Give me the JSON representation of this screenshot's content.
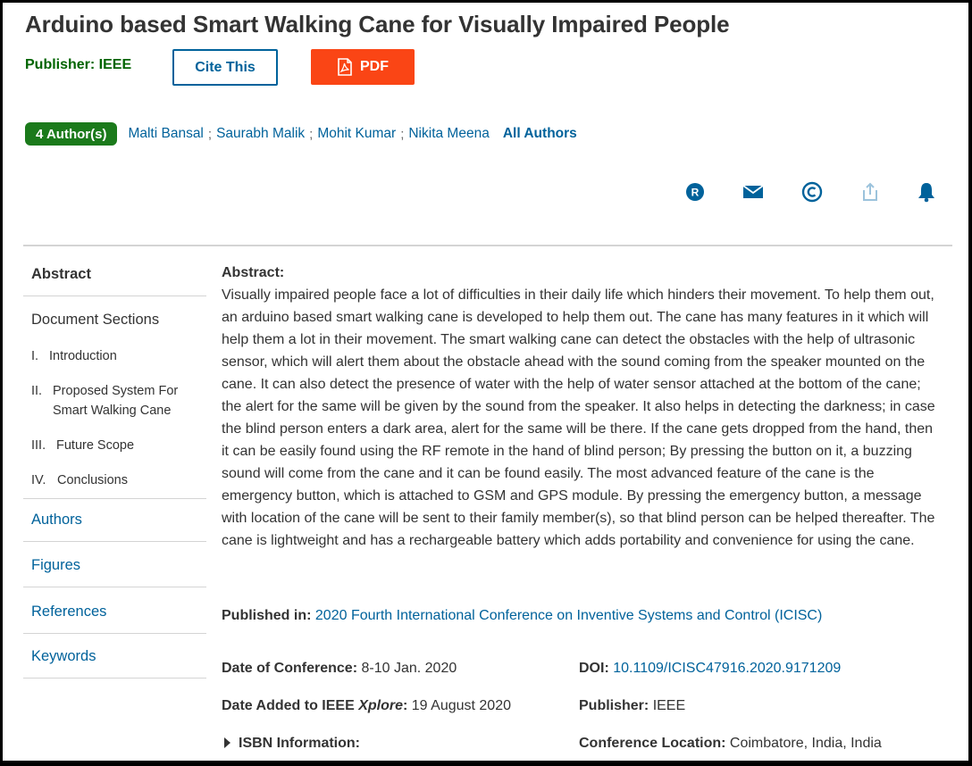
{
  "article": {
    "title": "Arduino based Smart Walking Cane for Visually Impaired People",
    "publisher_label": "Publisher: IEEE",
    "cite_label": "Cite This",
    "pdf_label": "PDF"
  },
  "authors": {
    "badge": "4 Author(s)",
    "names": [
      "Malti Bansal",
      "Saurabh Malik",
      "Mohit Kumar",
      "Nikita Meena"
    ],
    "separator": ";",
    "all_label": "All Authors"
  },
  "action_icons": [
    "rightslink-icon",
    "email-icon",
    "copyright-icon",
    "share-icon",
    "alert-bell-icon"
  ],
  "colors": {
    "link": "#00629b",
    "publisher_green": "#006400",
    "badge_green": "#1b7a1b",
    "pdf_orange": "#fa4515"
  },
  "sidebar": {
    "abstract": "Abstract",
    "document_sections": "Document Sections",
    "sections": [
      {
        "num": "I.",
        "label": "Introduction"
      },
      {
        "num": "II.",
        "label": "Proposed System For Smart Walking Cane"
      },
      {
        "num": "III.",
        "label": "Future Scope"
      },
      {
        "num": "IV.",
        "label": "Conclusions"
      }
    ],
    "authors": "Authors",
    "figures": "Figures",
    "references": "References",
    "keywords": "Keywords"
  },
  "abstract": {
    "heading": "Abstract:",
    "text": "Visually impaired people face a lot of difficulties in their daily life which hinders their movement. To help them out, an arduino based smart walking cane is developed to help them out. The cane has many features in it which will help them a lot in their movement. The smart walking cane can detect the obstacles with the help of ultrasonic sensor, which will alert them about the obstacle ahead with the sound coming from the speaker mounted on the cane. It can also detect the presence of water with the help of water sensor attached at the bottom of the cane; the alert for the same will be given by the sound from the speaker. It also helps in detecting the darkness; in case the blind person enters a dark area, alert for the same will be there. If the cane gets dropped from the hand, then it can be easily found using the RF remote in the hand of blind person; By pressing the button on it, a buzzing sound will come from the cane and it can be found easily. The most advanced feature of the cane is the emergency button, which is attached to GSM and GPS module. By pressing the emergency button, a message with location of the cane will be sent to their family member(s), so that blind person can be helped thereafter. The cane is lightweight and has a rechargeable battery which adds portability and convenience for using the cane."
  },
  "meta": {
    "published_in_label": "Published in:",
    "published_in_value": "2020 Fourth International Conference on Inventive Systems and Control (ICISC)",
    "conf_date_label": "Date of Conference:",
    "conf_date_value": "8-10 Jan. 2020",
    "doi_label": "DOI:",
    "doi_value": "10.1109/ICISC47916.2020.9171209",
    "date_added_label_a": "Date Added to IEEE ",
    "date_added_label_b": "Xplore",
    "date_added_label_c": ":",
    "date_added_value": "19 August 2020",
    "publisher_label": "Publisher:",
    "publisher_value": "IEEE",
    "isbn_label": "ISBN Information:",
    "location_label": "Conference Location:",
    "location_value": "Coimbatore, India, India"
  }
}
